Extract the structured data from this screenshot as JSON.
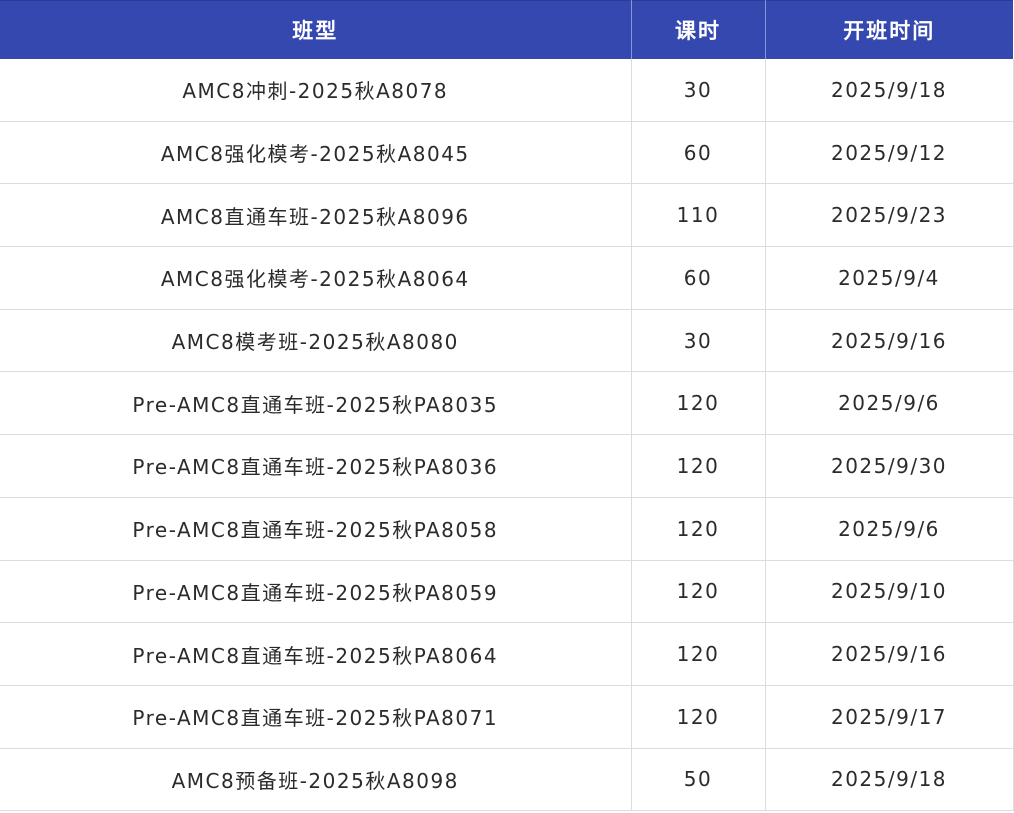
{
  "headers": {
    "class_type": "班型",
    "hours": "课时",
    "start_date": "开班时间"
  },
  "rows": [
    {
      "class_type": "AMC8冲刺-2025秋A8078",
      "hours": "30",
      "start_date": "2025/9/18"
    },
    {
      "class_type": "AMC8强化模考-2025秋A8045",
      "hours": "60",
      "start_date": "2025/9/12"
    },
    {
      "class_type": "AMC8直通车班-2025秋A8096",
      "hours": "110",
      "start_date": "2025/9/23"
    },
    {
      "class_type": "AMC8强化模考-2025秋A8064",
      "hours": "60",
      "start_date": "2025/9/4"
    },
    {
      "class_type": "AMC8模考班-2025秋A8080",
      "hours": "30",
      "start_date": "2025/9/16"
    },
    {
      "class_type": "Pre-AMC8直通车班-2025秋PA8035",
      "hours": "120",
      "start_date": "2025/9/6"
    },
    {
      "class_type": "Pre-AMC8直通车班-2025秋PA8036",
      "hours": "120",
      "start_date": "2025/9/30"
    },
    {
      "class_type": "Pre-AMC8直通车班-2025秋PA8058",
      "hours": "120",
      "start_date": "2025/9/6"
    },
    {
      "class_type": "Pre-AMC8直通车班-2025秋PA8059",
      "hours": "120",
      "start_date": "2025/9/10"
    },
    {
      "class_type": "Pre-AMC8直通车班-2025秋PA8064",
      "hours": "120",
      "start_date": "2025/9/16"
    },
    {
      "class_type": "Pre-AMC8直通车班-2025秋PA8071",
      "hours": "120",
      "start_date": "2025/9/17"
    },
    {
      "class_type": "AMC8预备班-2025秋A8098",
      "hours": "50",
      "start_date": "2025/9/18"
    }
  ],
  "colors": {
    "header_bg": "#3548b0",
    "header_text": "#ffffff",
    "body_text": "#2b2b2b",
    "grid_line": "#dcdcdc"
  }
}
